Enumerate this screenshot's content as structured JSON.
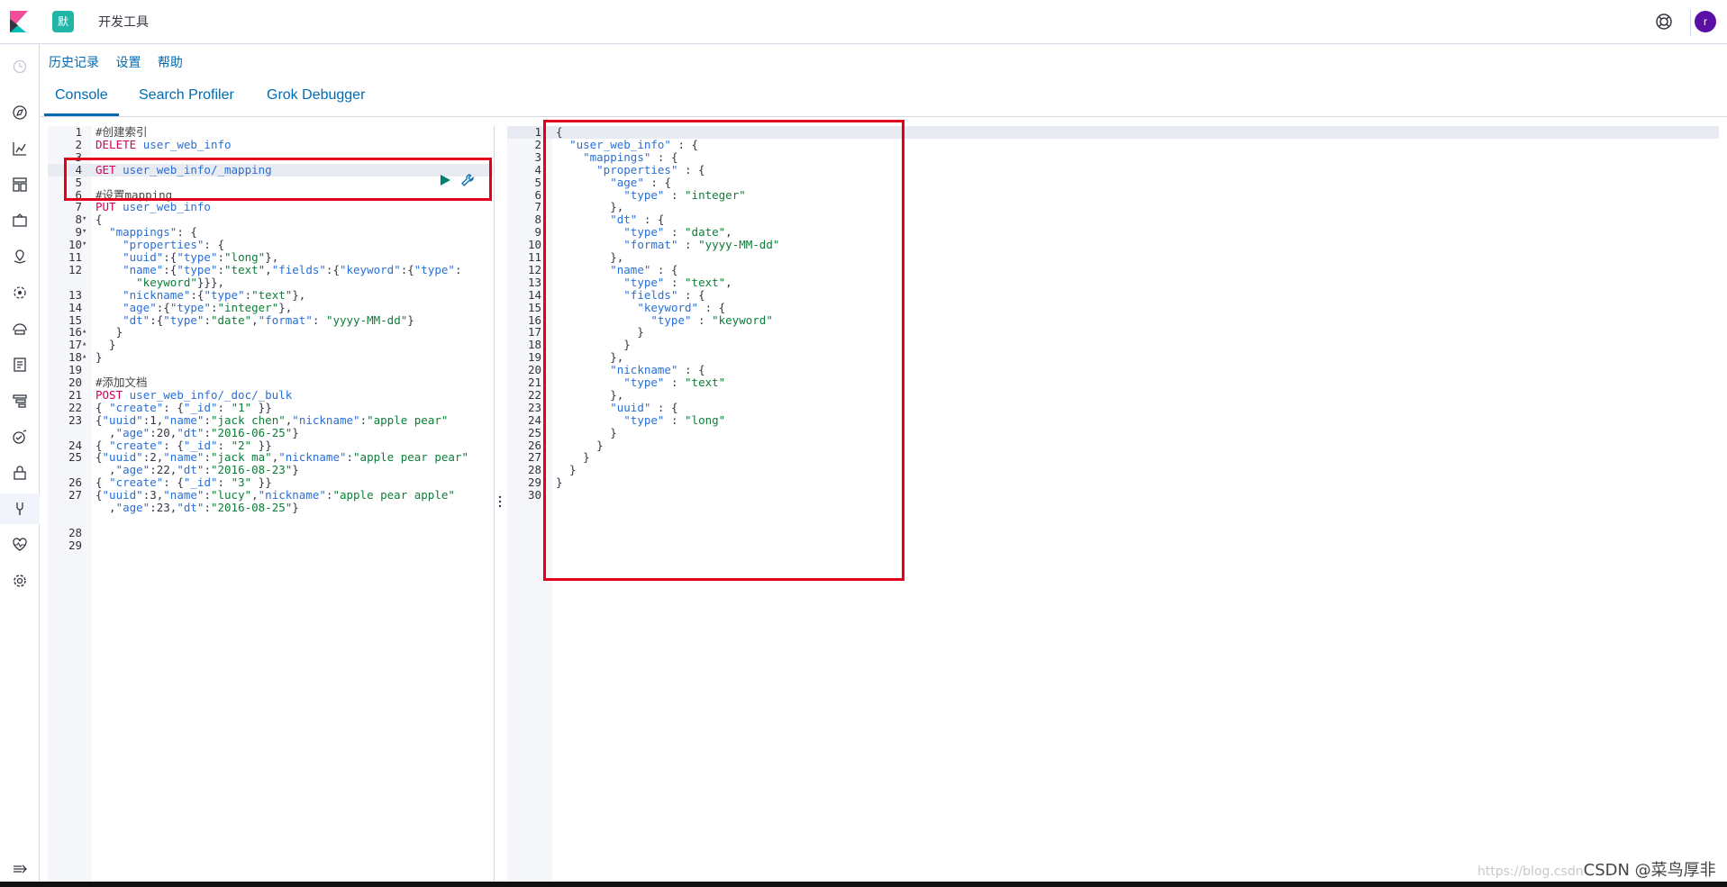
{
  "header": {
    "space_initial": "默",
    "app_title": "开发工具",
    "user_initial": "r"
  },
  "subnav": {
    "history": "历史记录",
    "settings": "设置",
    "help": "帮助"
  },
  "tabs": [
    {
      "label": "Console",
      "active": true
    },
    {
      "label": "Search Profiler",
      "active": false
    },
    {
      "label": "Grok Debugger",
      "active": false
    }
  ],
  "nav_icons": [
    "clock-icon",
    "compass-icon",
    "visualize-icon",
    "dashboard-icon",
    "canvas-icon",
    "maps-icon",
    "ml-icon",
    "infrastructure-icon",
    "logs-icon",
    "apm-icon",
    "uptime-icon",
    "siem-icon",
    "devtools-icon",
    "monitoring-icon",
    "management-icon",
    "collapse-icon"
  ],
  "left_editor": {
    "lines": [
      {
        "n": "1",
        "text": "#创建索引"
      },
      {
        "n": "2",
        "text": "DELETE user_web_info"
      },
      {
        "n": "3",
        "text": ""
      },
      {
        "n": "4",
        "text": "GET user_web_info/_mapping"
      },
      {
        "n": "5",
        "text": ""
      },
      {
        "n": "6",
        "text": "#设置mapping"
      },
      {
        "n": "7",
        "text": "PUT user_web_info"
      },
      {
        "n": "8",
        "text": "{"
      },
      {
        "n": "9",
        "text": "  \"mappings\": {"
      },
      {
        "n": "10",
        "text": "    \"properties\": {"
      },
      {
        "n": "11",
        "text": "    \"uuid\":{\"type\":\"long\"},"
      },
      {
        "n": "12",
        "text": "    \"name\":{\"type\":\"text\",\"fields\":{\"keyword\":{\"type\":"
      },
      {
        "n": "",
        "text": "      \"keyword\"}}},"
      },
      {
        "n": "13",
        "text": "    \"nickname\":{\"type\":\"text\"},"
      },
      {
        "n": "14",
        "text": "    \"age\":{\"type\":\"integer\"},"
      },
      {
        "n": "15",
        "text": "    \"dt\":{\"type\":\"date\",\"format\": \"yyyy-MM-dd\"}"
      },
      {
        "n": "16",
        "text": "   }"
      },
      {
        "n": "17",
        "text": "  }"
      },
      {
        "n": "18",
        "text": "}"
      },
      {
        "n": "19",
        "text": ""
      },
      {
        "n": "20",
        "text": "#添加文档"
      },
      {
        "n": "21",
        "text": "POST user_web_info/_doc/_bulk"
      },
      {
        "n": "22",
        "text": "{ \"create\": {\"_id\": \"1\" }}"
      },
      {
        "n": "23",
        "text": "{\"uuid\":1,\"name\":\"jack chen\",\"nickname\":\"apple pear\""
      },
      {
        "n": "",
        "text": "  ,\"age\":20,\"dt\":\"2016-06-25\"}"
      },
      {
        "n": "24",
        "text": "{ \"create\": {\"_id\": \"2\" }}"
      },
      {
        "n": "25",
        "text": "{\"uuid\":2,\"name\":\"jack ma\",\"nickname\":\"apple pear pear\""
      },
      {
        "n": "",
        "text": "  ,\"age\":22,\"dt\":\"2016-08-23\"}"
      },
      {
        "n": "26",
        "text": "{ \"create\": {\"_id\": \"3\" }}"
      },
      {
        "n": "27",
        "text": "{\"uuid\":3,\"name\":\"lucy\",\"nickname\":\"apple pear apple\""
      },
      {
        "n": "",
        "text": "  ,\"age\":23,\"dt\":\"2016-08-25\"}"
      },
      {
        "n": "",
        "text": ""
      },
      {
        "n": "28",
        "text": ""
      },
      {
        "n": "29",
        "text": ""
      }
    ]
  },
  "right_editor": {
    "lines": [
      {
        "n": "1",
        "text": "{"
      },
      {
        "n": "2",
        "text": "  \"user_web_info\" : {"
      },
      {
        "n": "3",
        "text": "    \"mappings\" : {"
      },
      {
        "n": "4",
        "text": "      \"properties\" : {"
      },
      {
        "n": "5",
        "text": "        \"age\" : {"
      },
      {
        "n": "6",
        "text": "          \"type\" : \"integer\""
      },
      {
        "n": "7",
        "text": "        },"
      },
      {
        "n": "8",
        "text": "        \"dt\" : {"
      },
      {
        "n": "9",
        "text": "          \"type\" : \"date\","
      },
      {
        "n": "10",
        "text": "          \"format\" : \"yyyy-MM-dd\""
      },
      {
        "n": "11",
        "text": "        },"
      },
      {
        "n": "12",
        "text": "        \"name\" : {"
      },
      {
        "n": "13",
        "text": "          \"type\" : \"text\","
      },
      {
        "n": "14",
        "text": "          \"fields\" : {"
      },
      {
        "n": "15",
        "text": "            \"keyword\" : {"
      },
      {
        "n": "16",
        "text": "              \"type\" : \"keyword\""
      },
      {
        "n": "17",
        "text": "            }"
      },
      {
        "n": "18",
        "text": "          }"
      },
      {
        "n": "19",
        "text": "        },"
      },
      {
        "n": "20",
        "text": "        \"nickname\" : {"
      },
      {
        "n": "21",
        "text": "          \"type\" : \"text\""
      },
      {
        "n": "22",
        "text": "        },"
      },
      {
        "n": "23",
        "text": "        \"uuid\" : {"
      },
      {
        "n": "24",
        "text": "          \"type\" : \"long\""
      },
      {
        "n": "25",
        "text": "        }"
      },
      {
        "n": "26",
        "text": "      }"
      },
      {
        "n": "27",
        "text": "    }"
      },
      {
        "n": "28",
        "text": "  }"
      },
      {
        "n": "29",
        "text": "}"
      },
      {
        "n": "30",
        "text": ""
      }
    ]
  },
  "watermark": {
    "url": "https://blog.csdn",
    "text": "CSDN @菜鸟厚非"
  }
}
